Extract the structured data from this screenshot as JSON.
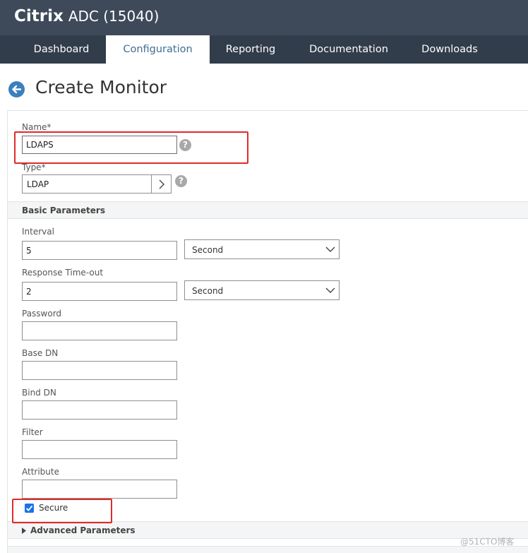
{
  "header": {
    "brand_strong": "Citrix",
    "brand_rest": "ADC (15040)"
  },
  "nav": {
    "tabs": [
      {
        "label": "Dashboard",
        "active": false
      },
      {
        "label": "Configuration",
        "active": true
      },
      {
        "label": "Reporting",
        "active": false
      },
      {
        "label": "Documentation",
        "active": false
      },
      {
        "label": "Downloads",
        "active": false
      }
    ]
  },
  "page": {
    "title": "Create Monitor"
  },
  "form": {
    "name_label": "Name*",
    "name_value": "LDAPS",
    "type_label": "Type*",
    "type_value": "LDAP",
    "help_glyph": "?",
    "basic_section_title": "Basic Parameters",
    "interval_label": "Interval",
    "interval_value": "5",
    "interval_unit": "Second",
    "response_timeout_label": "Response Time-out",
    "response_timeout_value": "2",
    "response_timeout_unit": "Second",
    "password_label": "Password",
    "password_value": "",
    "base_dn_label": "Base DN",
    "base_dn_value": "",
    "bind_dn_label": "Bind DN",
    "bind_dn_value": "",
    "filter_label": "Filter",
    "filter_value": "",
    "attribute_label": "Attribute",
    "attribute_value": "",
    "secure_label": "Secure",
    "secure_checked": true,
    "advanced_section_title": "Advanced Parameters"
  },
  "watermark": "@51CTO博客",
  "colors": {
    "topbar": "#3e4a5a",
    "navbar": "#323d4b",
    "active_tab_text": "#3f6f92",
    "back_button": "#3c7fbe",
    "highlight": "#e02a2a",
    "checkbox": "#1a73e8"
  },
  "icons": {
    "back": "arrow-left-circle-icon",
    "help": "question-circle-icon",
    "type_picker": "chevron-right-icon",
    "select": "chevron-down-icon",
    "advanced_toggle": "triangle-right-icon"
  }
}
